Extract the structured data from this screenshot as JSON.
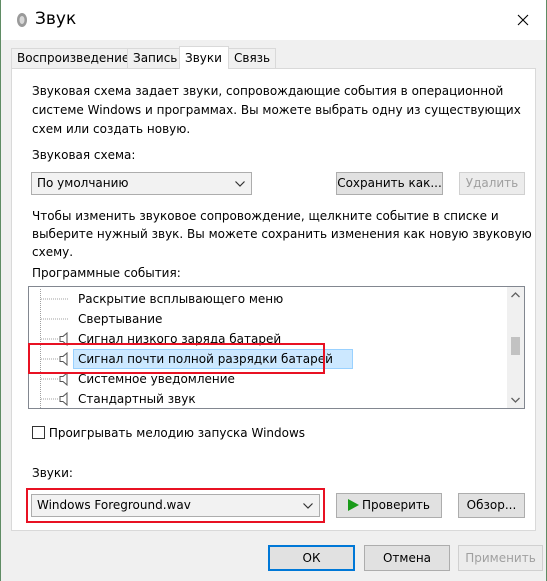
{
  "window": {
    "title": "Звук"
  },
  "tabs": [
    {
      "label": "Воспроизведение"
    },
    {
      "label": "Запись"
    },
    {
      "label": "Звуки"
    },
    {
      "label": "Связь"
    }
  ],
  "intro_text": [
    "Звуковая схема задает звуки, сопровождающие события в операционной",
    "системе Windows и программах. Вы можете выбрать одну из существующих",
    "схем или создать новую."
  ],
  "scheme": {
    "label": "Звуковая схема:",
    "value": "По умолчанию",
    "save_label": "Сохранить как...",
    "delete_label": "Удалить"
  },
  "change_text": [
    "Чтобы изменить звуковое сопровождение, щелкните событие в списке и",
    "выберите нужный звук. Вы можете сохранить изменения как новую звуковую",
    "схему."
  ],
  "events": {
    "label": "Программные события:",
    "items": [
      {
        "label": "Раскрытие всплывающего меню",
        "has_sound": false
      },
      {
        "label": "Свертывание",
        "has_sound": false
      },
      {
        "label": "Сигнал низкого заряда батарей",
        "has_sound": true
      },
      {
        "label": "Сигнал почти полной разрядки батарей",
        "has_sound": true,
        "selected": true
      },
      {
        "label": "Системное уведомление",
        "has_sound": true
      },
      {
        "label": "Стандартный звук",
        "has_sound": true
      }
    ]
  },
  "startup": {
    "label": "Проигрывать мелодию запуска Windows",
    "checked": false
  },
  "sounds": {
    "label": "Звуки:",
    "value": "Windows Foreground.wav",
    "test_label": "Проверить",
    "browse_label": "Обзор..."
  },
  "footer": {
    "ok_label": "ОК",
    "cancel_label": "Отмена",
    "apply_label": "Применить"
  },
  "colors": {
    "highlight": "#e81123",
    "selection": "#cce8ff",
    "play": "#1a9b1a"
  }
}
